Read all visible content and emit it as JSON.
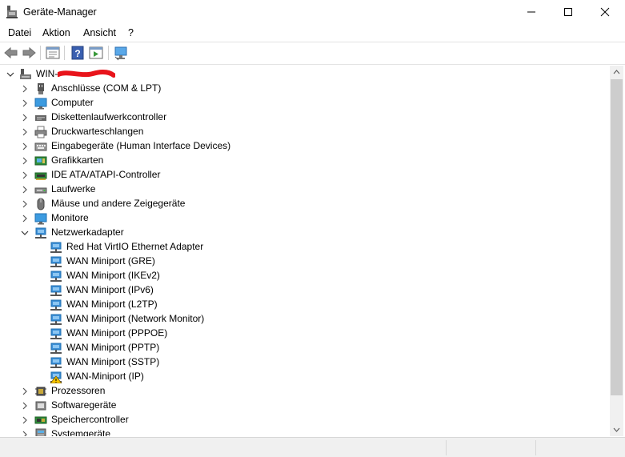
{
  "window": {
    "title": "Geräte-Manager",
    "minimize_glyph": "–",
    "maximize_glyph": "□",
    "close_glyph": "✕"
  },
  "menu": {
    "items": [
      "Datei",
      "Aktion",
      "Ansicht",
      "?"
    ]
  },
  "toolbar": {
    "buttons": [
      "back-icon",
      "forward-icon",
      "properties-icon",
      "help-icon",
      "run-icon",
      "scan-hardware-icon"
    ]
  },
  "tree": {
    "root": {
      "label": "WIN-",
      "redacted": true
    },
    "categories": [
      {
        "label": "Anschlüsse (COM & LPT)",
        "icon": "port-icon"
      },
      {
        "label": "Computer",
        "icon": "computer-icon"
      },
      {
        "label": "Diskettenlaufwerkcontroller",
        "icon": "floppy-controller-icon"
      },
      {
        "label": "Druckwarteschlangen",
        "icon": "printer-icon"
      },
      {
        "label": "Eingabegeräte (Human Interface Devices)",
        "icon": "hid-icon"
      },
      {
        "label": "Grafikkarten",
        "icon": "display-adapter-icon"
      },
      {
        "label": "IDE ATA/ATAPI-Controller",
        "icon": "ide-controller-icon"
      },
      {
        "label": "Laufwerke",
        "icon": "drive-icon"
      },
      {
        "label": "Mäuse und andere Zeigegeräte",
        "icon": "mouse-icon"
      },
      {
        "label": "Monitore",
        "icon": "monitor-icon"
      },
      {
        "label": "Netzwerkadapter",
        "icon": "network-adapter-icon",
        "expanded": true
      }
    ],
    "network_children": [
      {
        "label": "Red Hat VirtIO Ethernet Adapter",
        "warning": false
      },
      {
        "label": "WAN Miniport (GRE)",
        "warning": false
      },
      {
        "label": "WAN Miniport (IKEv2)",
        "warning": false
      },
      {
        "label": "WAN Miniport (IPv6)",
        "warning": false
      },
      {
        "label": "WAN Miniport (L2TP)",
        "warning": false
      },
      {
        "label": "WAN Miniport (Network Monitor)",
        "warning": false
      },
      {
        "label": "WAN Miniport (PPPOE)",
        "warning": false
      },
      {
        "label": "WAN Miniport (PPTP)",
        "warning": false
      },
      {
        "label": "WAN Miniport (SSTP)",
        "warning": false
      },
      {
        "label": "WAN-Miniport (IP)",
        "warning": true
      }
    ],
    "more_categories": [
      {
        "label": "Prozessoren",
        "icon": "processor-icon"
      },
      {
        "label": "Softwaregeräte",
        "icon": "software-device-icon"
      },
      {
        "label": "Speichercontroller",
        "icon": "storage-controller-icon"
      },
      {
        "label": "Systemgeräte",
        "icon": "system-device-icon"
      }
    ]
  },
  "colors": {
    "redaction": "#e8141b",
    "network_blue": "#3c8fd6",
    "warning_yellow": "#f5c400"
  }
}
